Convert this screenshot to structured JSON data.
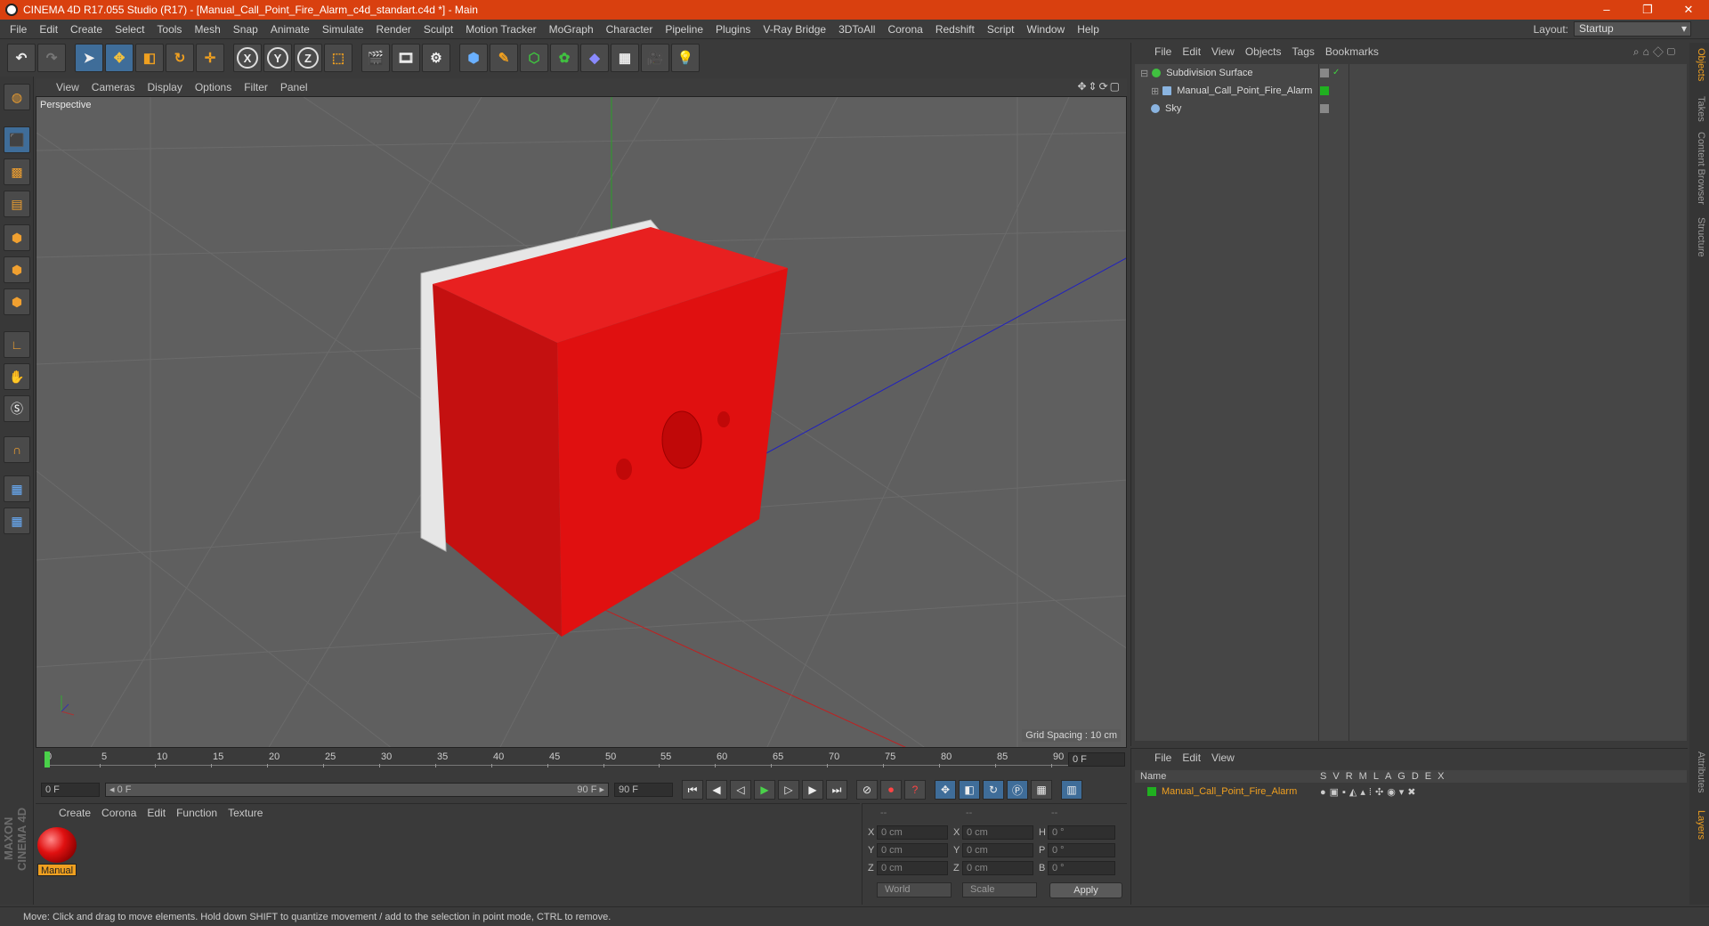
{
  "window": {
    "title": "CINEMA 4D R17.055 Studio (R17) - [Manual_Call_Point_Fire_Alarm_c4d_standart.c4d *] - Main",
    "controls": [
      "–",
      "❐",
      "✕"
    ]
  },
  "menubar": {
    "items": [
      "File",
      "Edit",
      "Create",
      "Select",
      "Tools",
      "Mesh",
      "Snap",
      "Animate",
      "Simulate",
      "Render",
      "Sculpt",
      "Motion Tracker",
      "MoGraph",
      "Character",
      "Pipeline",
      "Plugins",
      "V-Ray Bridge",
      "3DToAll",
      "Corona",
      "Redshift",
      "Script",
      "Window",
      "Help"
    ],
    "layout_label": "Layout:",
    "layout_value": "Startup"
  },
  "toolbar": {
    "undo_icon": "undo-icon",
    "axis_x": "X",
    "axis_y": "Y",
    "axis_z": "Z"
  },
  "viewport": {
    "menu": [
      "View",
      "Cameras",
      "Display",
      "Options",
      "Filter",
      "Panel"
    ],
    "label": "Perspective",
    "grid_spacing": "Grid Spacing : 10 cm",
    "object_color": "#e01010"
  },
  "timeline": {
    "ticks": [
      "0",
      "5",
      "10",
      "15",
      "20",
      "25",
      "30",
      "35",
      "40",
      "45",
      "50",
      "55",
      "60",
      "65",
      "70",
      "75",
      "80",
      "85",
      "90"
    ],
    "current_frame": "0 F",
    "start_field": "0 F",
    "range_start": "◂ 0 F",
    "range_end": "90 F ▸",
    "end_field": "90 F"
  },
  "material_manager": {
    "menu": [
      "Create",
      "Corona",
      "Edit",
      "Function",
      "Texture"
    ],
    "material_name": "Manual"
  },
  "coordinates": {
    "header": [
      "--",
      "--",
      "--"
    ],
    "rows": [
      {
        "a": "X",
        "av": "0 cm",
        "b": "X",
        "bv": "0 cm",
        "c": "H",
        "cv": "0 °"
      },
      {
        "a": "Y",
        "av": "0 cm",
        "b": "Y",
        "bv": "0 cm",
        "c": "P",
        "cv": "0 °"
      },
      {
        "a": "Z",
        "av": "0 cm",
        "b": "Z",
        "bv": "0 cm",
        "c": "B",
        "cv": "0 °"
      }
    ],
    "mode": "World",
    "transform": "Scale",
    "apply": "Apply"
  },
  "status": {
    "text": "Move: Click and drag to move elements. Hold down SHIFT to quantize movement / add to the selection in point mode, CTRL to remove."
  },
  "object_manager": {
    "menu": [
      "File",
      "Edit",
      "View",
      "Objects",
      "Tags",
      "Bookmarks"
    ],
    "objects": [
      {
        "name": "Subdivision Surface",
        "color": "#40c040"
      },
      {
        "name": "Manual_Call_Point_Fire_Alarm",
        "color": "#8ab4e0"
      },
      {
        "name": "Sky",
        "color": "#8ab4e0"
      }
    ]
  },
  "right_tabs": [
    "Objects",
    "Takes",
    "Content Browser",
    "Structure",
    "Attributes",
    "Layers"
  ],
  "layer_manager": {
    "menu": [
      "File",
      "Edit",
      "View"
    ],
    "col_name": "Name",
    "cols": [
      "S",
      "V",
      "R",
      "M",
      "L",
      "A",
      "G",
      "D",
      "E",
      "X"
    ],
    "layer": "Manual_Call_Point_Fire_Alarm",
    "layer_color": "#20b020"
  }
}
